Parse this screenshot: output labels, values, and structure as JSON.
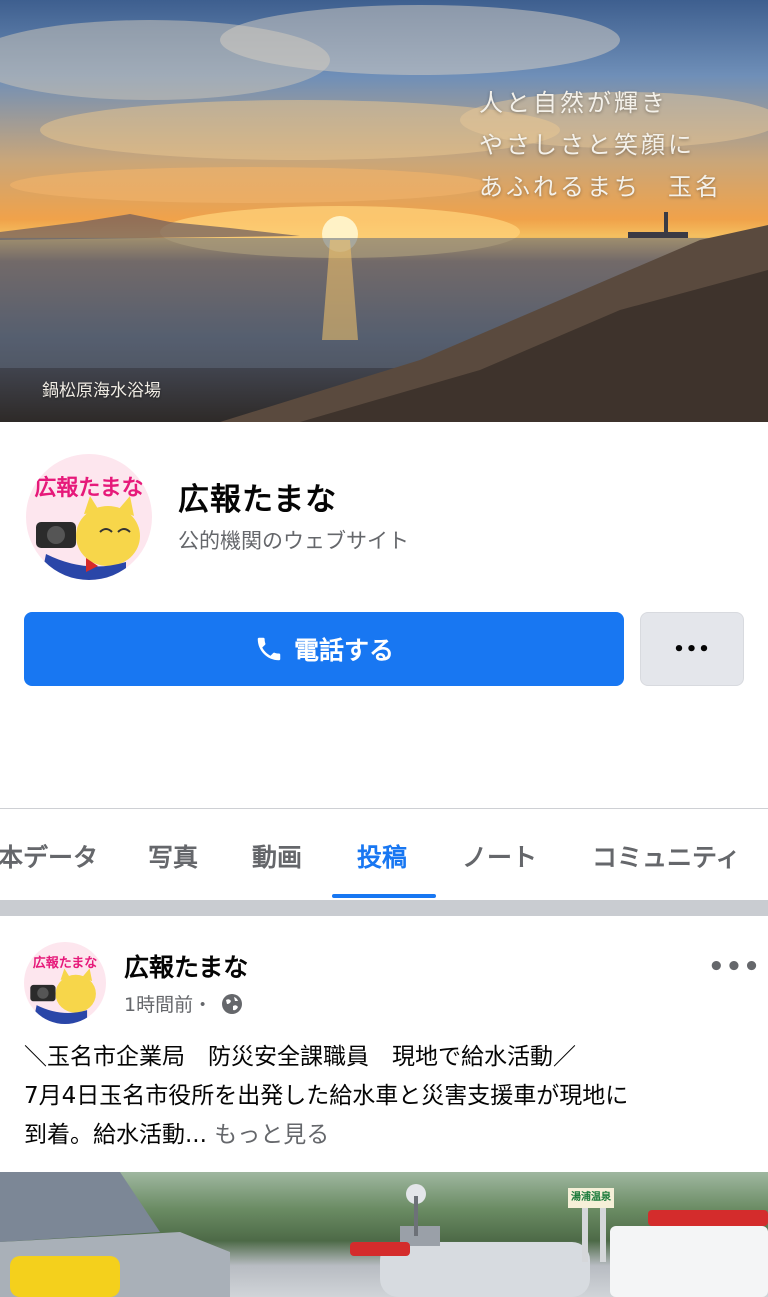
{
  "cover": {
    "slogan_line1": "人と自然が輝き",
    "slogan_line2": "やさしさと笑顔に",
    "slogan_line3": "あふれるまち　玉名",
    "caption": "鍋松原海水浴場"
  },
  "profile": {
    "avatar_text": "広報たまな",
    "name": "広報たまな",
    "category": "公的機関のウェブサイト"
  },
  "actions": {
    "call_label": "電話する",
    "more_label": "•••"
  },
  "tabs": [
    {
      "label": "本データ"
    },
    {
      "label": "写真"
    },
    {
      "label": "動画"
    },
    {
      "label": "投稿"
    },
    {
      "label": "ノート"
    },
    {
      "label": "コミュニティ"
    }
  ],
  "post": {
    "author": "広報たまな",
    "time": "1時間前・",
    "menu_label": "•••",
    "line1": "＼玉名市企業局　防災安全課職員　現地で給水活動／",
    "line2": "7月4日玉名市役所を出発した給水車と災害支援車が現地に",
    "line3": "到着。給水活動...",
    "see_more": "もっと見る",
    "image_sign": "湯浦温泉"
  },
  "colors": {
    "accent": "#1877f2",
    "secondary_text": "#65676b",
    "button_gray": "#e4e6eb"
  },
  "icons": [
    "phone-icon",
    "more-icon",
    "globe-icon"
  ]
}
